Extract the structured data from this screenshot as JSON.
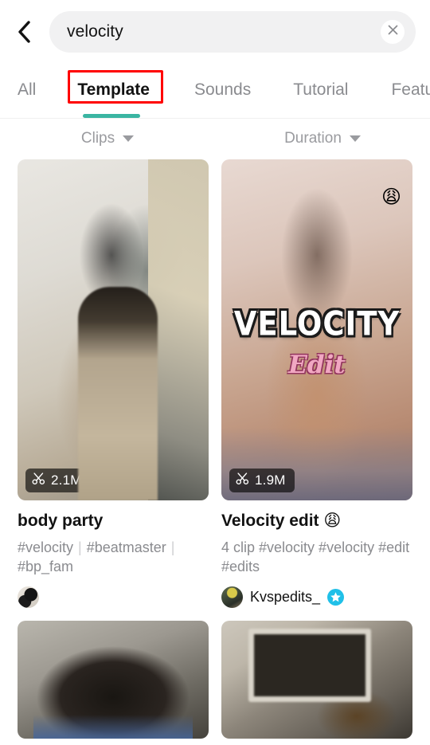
{
  "search": {
    "back_icon": "chevron-left-icon",
    "value": "velocity",
    "placeholder": "Search",
    "clear_icon": "close-icon"
  },
  "tabs": [
    {
      "id": "all",
      "label": "All",
      "active": false
    },
    {
      "id": "template",
      "label": "Template",
      "active": true
    },
    {
      "id": "sounds",
      "label": "Sounds",
      "active": false
    },
    {
      "id": "tutorial",
      "label": "Tutorial",
      "active": false
    },
    {
      "id": "feature",
      "label": "Feature",
      "active": false
    }
  ],
  "highlight": {
    "target": "Template",
    "color": "#ff0000"
  },
  "active_tab_underline_color": "#3ab5a2",
  "filters": [
    {
      "id": "clips",
      "label": "Clips",
      "icon": "chevron-down-icon"
    },
    {
      "id": "duration",
      "label": "Duration",
      "icon": "chevron-down-icon"
    }
  ],
  "cards": [
    {
      "id": "body-party",
      "title": "body party",
      "tags": [
        "#velocity",
        "#beatmaster",
        "#bp_fam"
      ],
      "clip_icon": "scissors-icon",
      "clip_count": "2.1M",
      "author": "",
      "verified": false,
      "overlay_emoji": "",
      "overlay_main": "",
      "overlay_sub": ""
    },
    {
      "id": "velocity-edit",
      "title": "Velocity edit 😩",
      "tags_text": "4 clip #velocity #velocity #edit #edits",
      "clip_icon": "scissors-icon",
      "clip_count": "1.9M",
      "author": "Kvspedits_",
      "verified": true,
      "verified_color": "#20c0e8",
      "overlay_emoji": "😩",
      "overlay_main": "VELOCITY",
      "overlay_sub": "Edit"
    },
    {
      "id": "row2-left",
      "title": "",
      "clip_count": ""
    },
    {
      "id": "row2-right",
      "title": "",
      "clip_count": ""
    }
  ]
}
